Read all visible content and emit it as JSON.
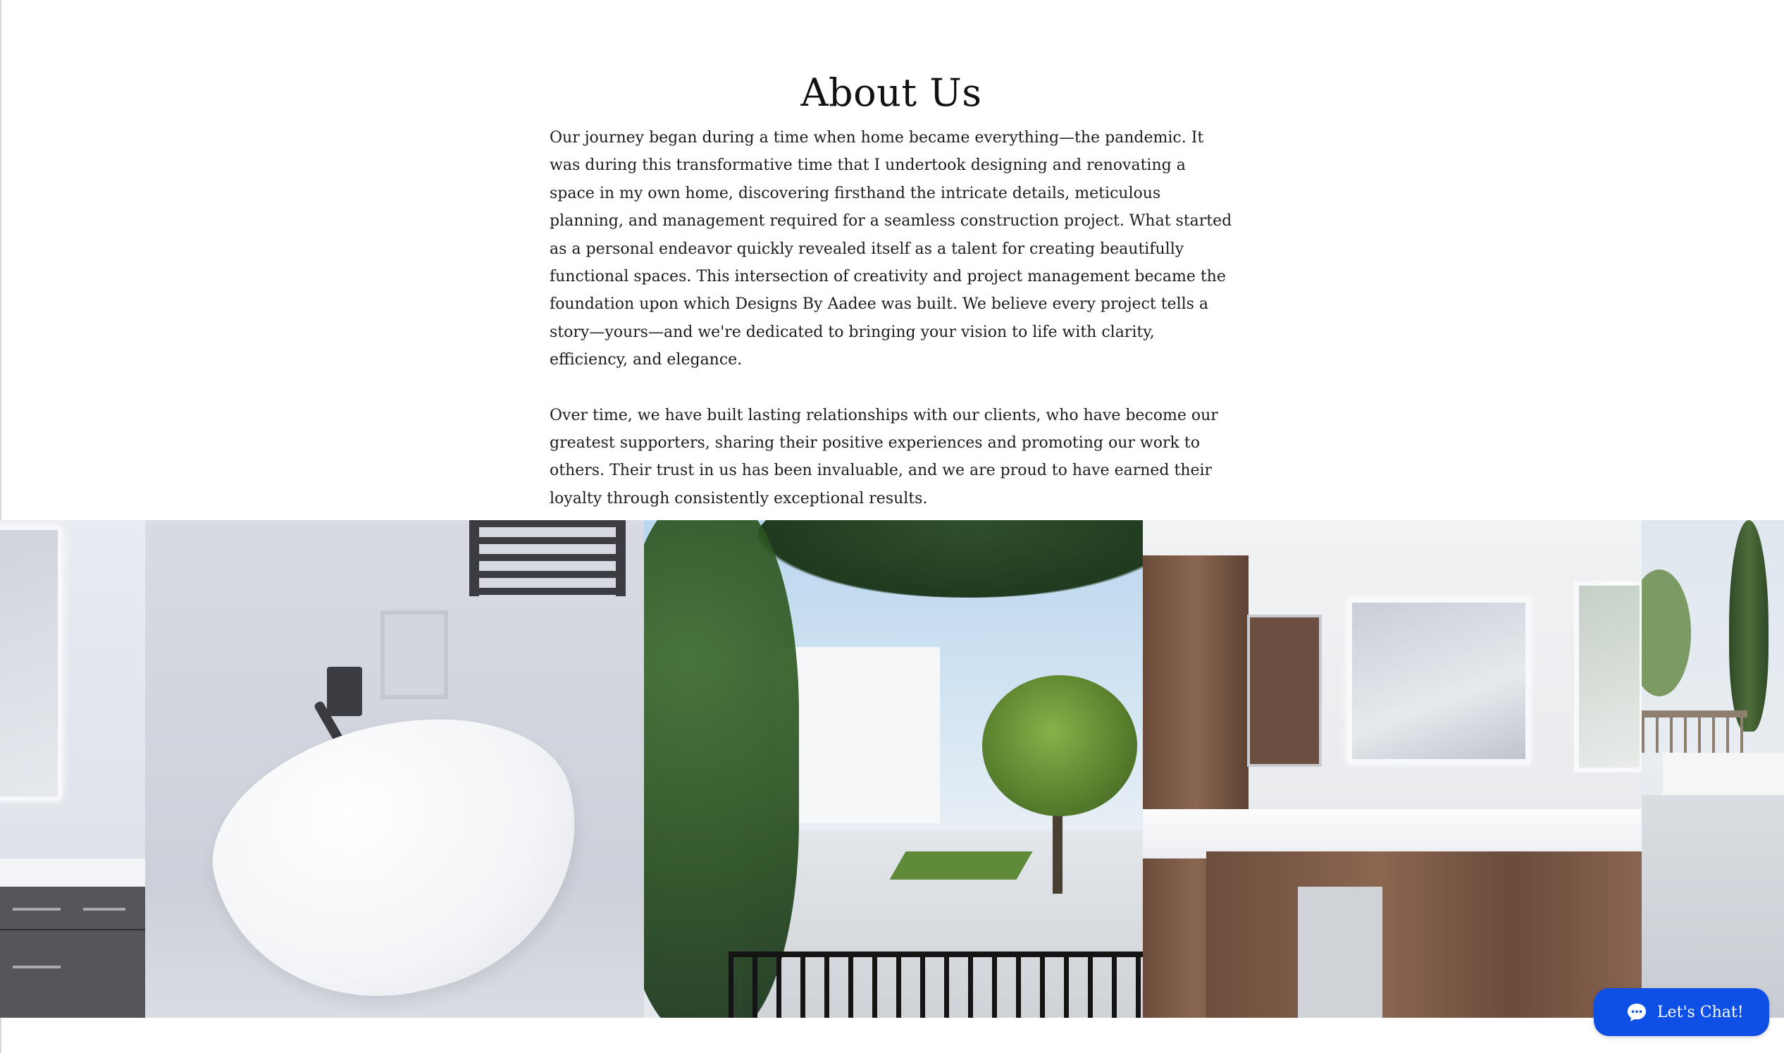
{
  "about": {
    "heading": "About Us",
    "paragraph_1": "Our journey began during a time when home became everything—the pandemic. It was during this transformative time that I undertook designing and renovating a space in my own home, discovering firsthand the intricate details, meticulous planning, and management required for a seamless construction project. What started as a personal endeavor quickly revealed itself as a talent for creating beautifully functional spaces. This intersection of creativity and project management became the foundation upon which Designs By Aadee was built. We believe every project tells a story—yours—and we're dedicated to bringing your vision to life with clarity, efficiency, and elegance.",
    "paragraph_2": "Over time, we have built lasting relationships with our clients, who have become our greatest supporters, sharing their positive experiences and promoting our work to others. Their trust in us has been invaluable, and we are proud to have earned their loyalty through consistently exceptional results."
  },
  "gallery": {
    "images": [
      {
        "name": "vanity-partial"
      },
      {
        "name": "freestanding-bathtub"
      },
      {
        "name": "backyard-patio"
      },
      {
        "name": "double-vanity"
      },
      {
        "name": "patio-partial"
      }
    ]
  },
  "chat": {
    "label": "Let's Chat!",
    "icon": "chat-bubble-icon",
    "color": "#0e4fe6"
  }
}
